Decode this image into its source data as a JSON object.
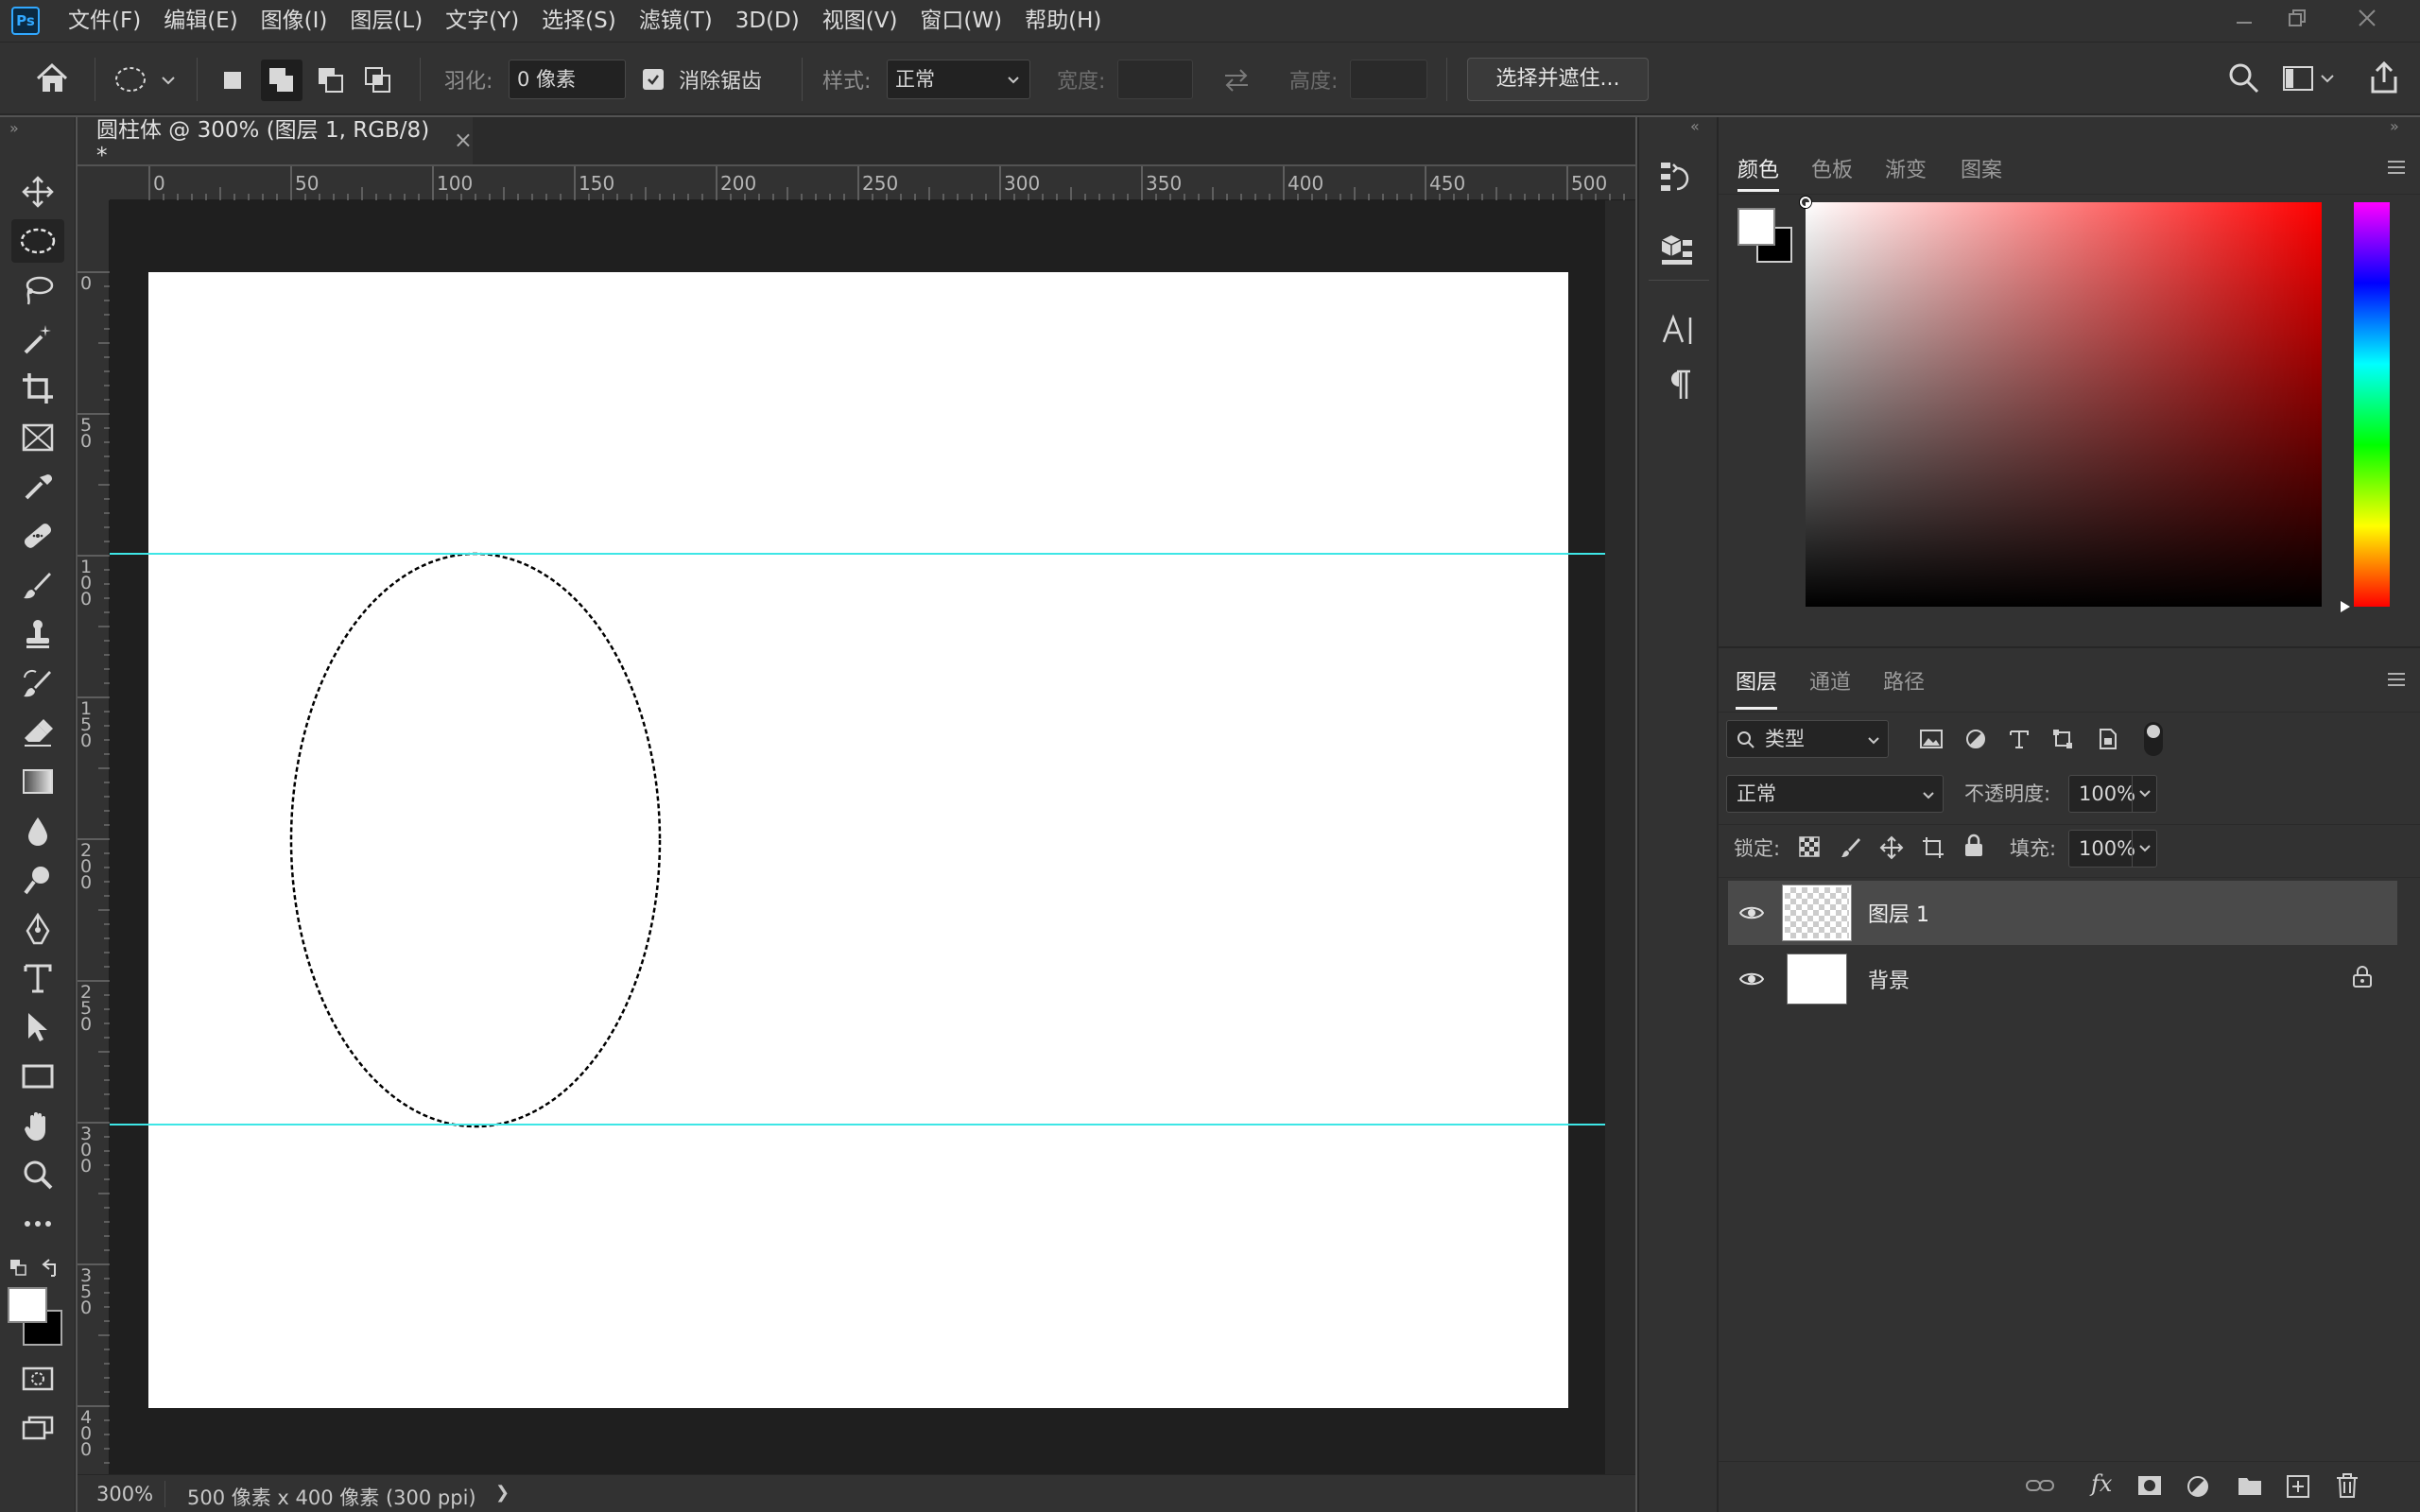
{
  "app": {
    "name": "Adobe Photoshop",
    "logo_text": "Ps"
  },
  "menu": [
    "文件(F)",
    "编辑(E)",
    "图像(I)",
    "图层(L)",
    "文字(Y)",
    "选择(S)",
    "滤镜(T)",
    "3D(D)",
    "视图(V)",
    "窗口(W)",
    "帮助(H)"
  ],
  "options": {
    "feather_label": "羽化:",
    "feather_value": "0 像素",
    "antialias_label": "消除锯齿",
    "antialias_checked": true,
    "style_label": "样式:",
    "style_value": "正常",
    "width_label": "宽度:",
    "height_label": "高度:",
    "select_mask_button": "选择并遮住..."
  },
  "document": {
    "tab_title": "圆柱体 @ 300% (图层 1, RGB/8) *",
    "close_glyph": "×",
    "zoom": "300%",
    "doc_info": "500 像素 x 400 像素 (300 ppi)",
    "status_arrow": "❯"
  },
  "rulers": {
    "top_labels": [
      "0",
      "50",
      "100",
      "150",
      "200",
      "250",
      "300",
      "350",
      "400",
      "450",
      "500"
    ],
    "left_labels": [
      [
        "0"
      ],
      [
        "5",
        "0"
      ],
      [
        "1",
        "0",
        "0"
      ],
      [
        "1",
        "5",
        "0"
      ],
      [
        "2",
        "0",
        "0"
      ],
      [
        "2",
        "5",
        "0"
      ],
      [
        "3",
        "0",
        "0"
      ],
      [
        "3",
        "5",
        "0"
      ],
      [
        "4",
        "0",
        "0"
      ]
    ]
  },
  "color_panel": {
    "tabs": [
      "颜色",
      "色板",
      "渐变",
      "图案"
    ],
    "active_tab": "颜色",
    "foreground": "#ffffff",
    "background": "#000000",
    "hue": "#ff0000"
  },
  "layers_panel": {
    "tabs": [
      "图层",
      "通道",
      "路径"
    ],
    "active_tab": "图层",
    "filter_label": "类型",
    "blend_mode": "正常",
    "opacity_label": "不透明度:",
    "opacity_value": "100%",
    "lock_label": "锁定:",
    "fill_label": "填充:",
    "fill_value": "100%",
    "layers": [
      {
        "name": "图层 1",
        "selected": true,
        "visible": true,
        "locked": false,
        "thumb": "transparent"
      },
      {
        "name": "背景",
        "selected": false,
        "visible": true,
        "locked": true,
        "thumb": "white"
      }
    ]
  },
  "colors": {
    "guide": "#3ee6e6",
    "accent": "#31a8ff"
  }
}
